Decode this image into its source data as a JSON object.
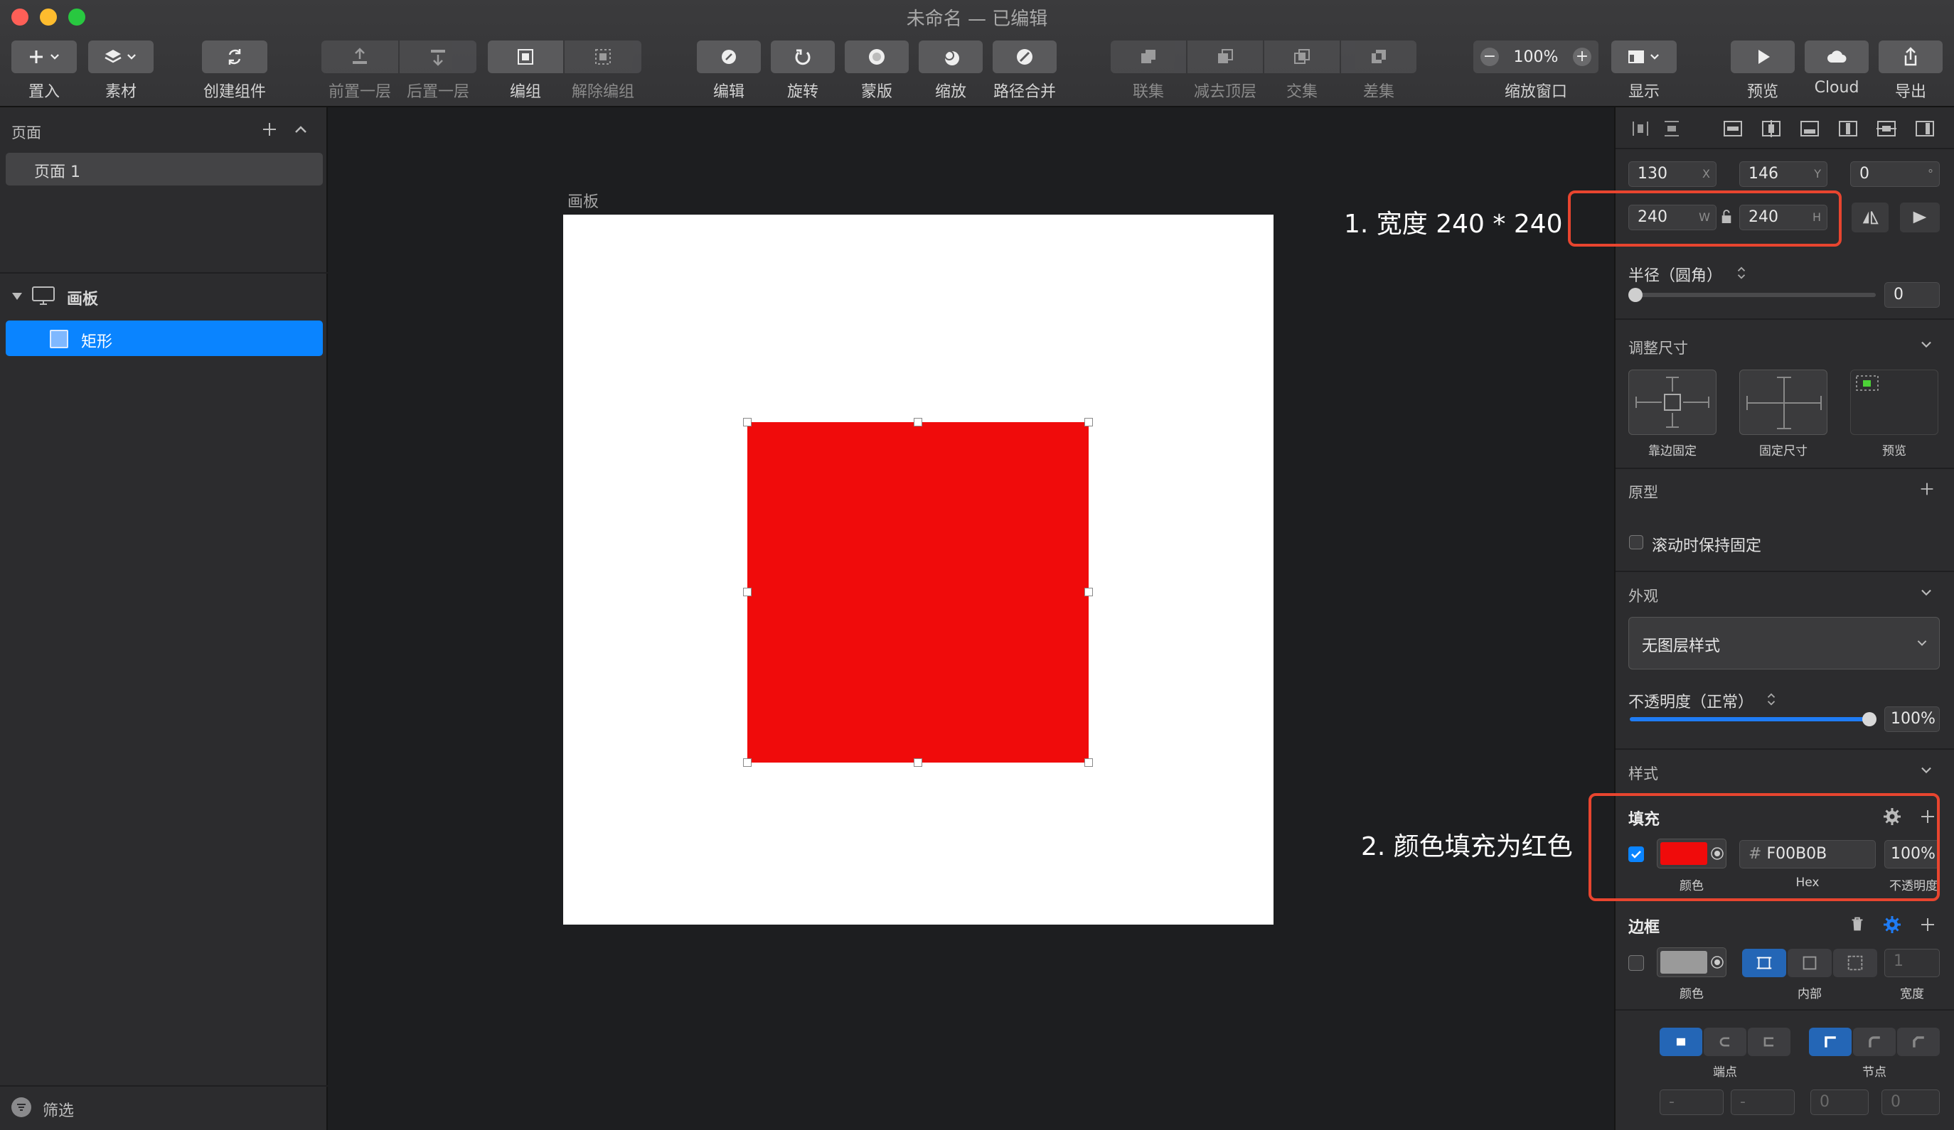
{
  "window": {
    "title": "未命名",
    "title_suffix": " — 已编辑"
  },
  "toolbar": {
    "insert": "置入",
    "assets": "素材",
    "create_component": "创建组件",
    "bring_forward": "前置一层",
    "send_backward": "后置一层",
    "group": "编组",
    "ungroup": "解除编组",
    "edit": "编辑",
    "rotate": "旋转",
    "mask": "蒙版",
    "scale": "缩放",
    "path_combine": "路径合并",
    "union": "联集",
    "subtract": "减去顶层",
    "intersect": "交集",
    "difference": "差集",
    "zoom_value": "100%",
    "zoom_window": "缩放窗口",
    "view": "显示",
    "preview": "预览",
    "cloud_icon_text": "Cloud",
    "export": "导出"
  },
  "pages_panel": {
    "header": "页面",
    "pages": [
      "页面 1"
    ],
    "artboard": "画板",
    "layer": "矩形",
    "filter": "筛选"
  },
  "canvas": {
    "artboard_label": "画板",
    "fill_color": "#F00B0B"
  },
  "inspector": {
    "x": "130",
    "y": "146",
    "rotation": "0",
    "w": "240",
    "h": "240",
    "x_suffix": "X",
    "y_suffix": "Y",
    "rot_suffix": "°",
    "w_suffix": "W",
    "h_suffix": "H",
    "radius_label": "半径（圆角）",
    "radius_value": "0",
    "resize_label": "调整尺寸",
    "pin_edges": "靠边固定",
    "fixed_size": "固定尺寸",
    "preview": "预览",
    "prototype_label": "原型",
    "fix_on_scroll": "滚动时保持固定",
    "appearance_label": "外观",
    "layer_style": "无图层样式",
    "opacity_label": "不透明度（正常）",
    "opacity_value": "100%",
    "style_label": "样式",
    "fill_label": "填充",
    "fill_hex": "F00B0B",
    "fill_hex_prefix": "#",
    "fill_opacity": "100%",
    "color_caption": "颜色",
    "hex_caption": "Hex",
    "opacity_caption": "不透明度",
    "border_label": "边框",
    "border_width": "1",
    "inside_caption": "内部",
    "width_caption": "宽度",
    "cap_caption": "端点",
    "joint_caption": "节点",
    "field_zero_a": "0",
    "field_zero_b": "0",
    "field_dash_a": "-",
    "field_dash_b": "-"
  },
  "annotations": {
    "step1": "1. 宽度 240 * 240",
    "step2": "2. 颜色填充为红色"
  },
  "colors": {
    "accent": "#0a84ff",
    "fill": "#F00B0B",
    "annotation_box": "#e8452f"
  }
}
